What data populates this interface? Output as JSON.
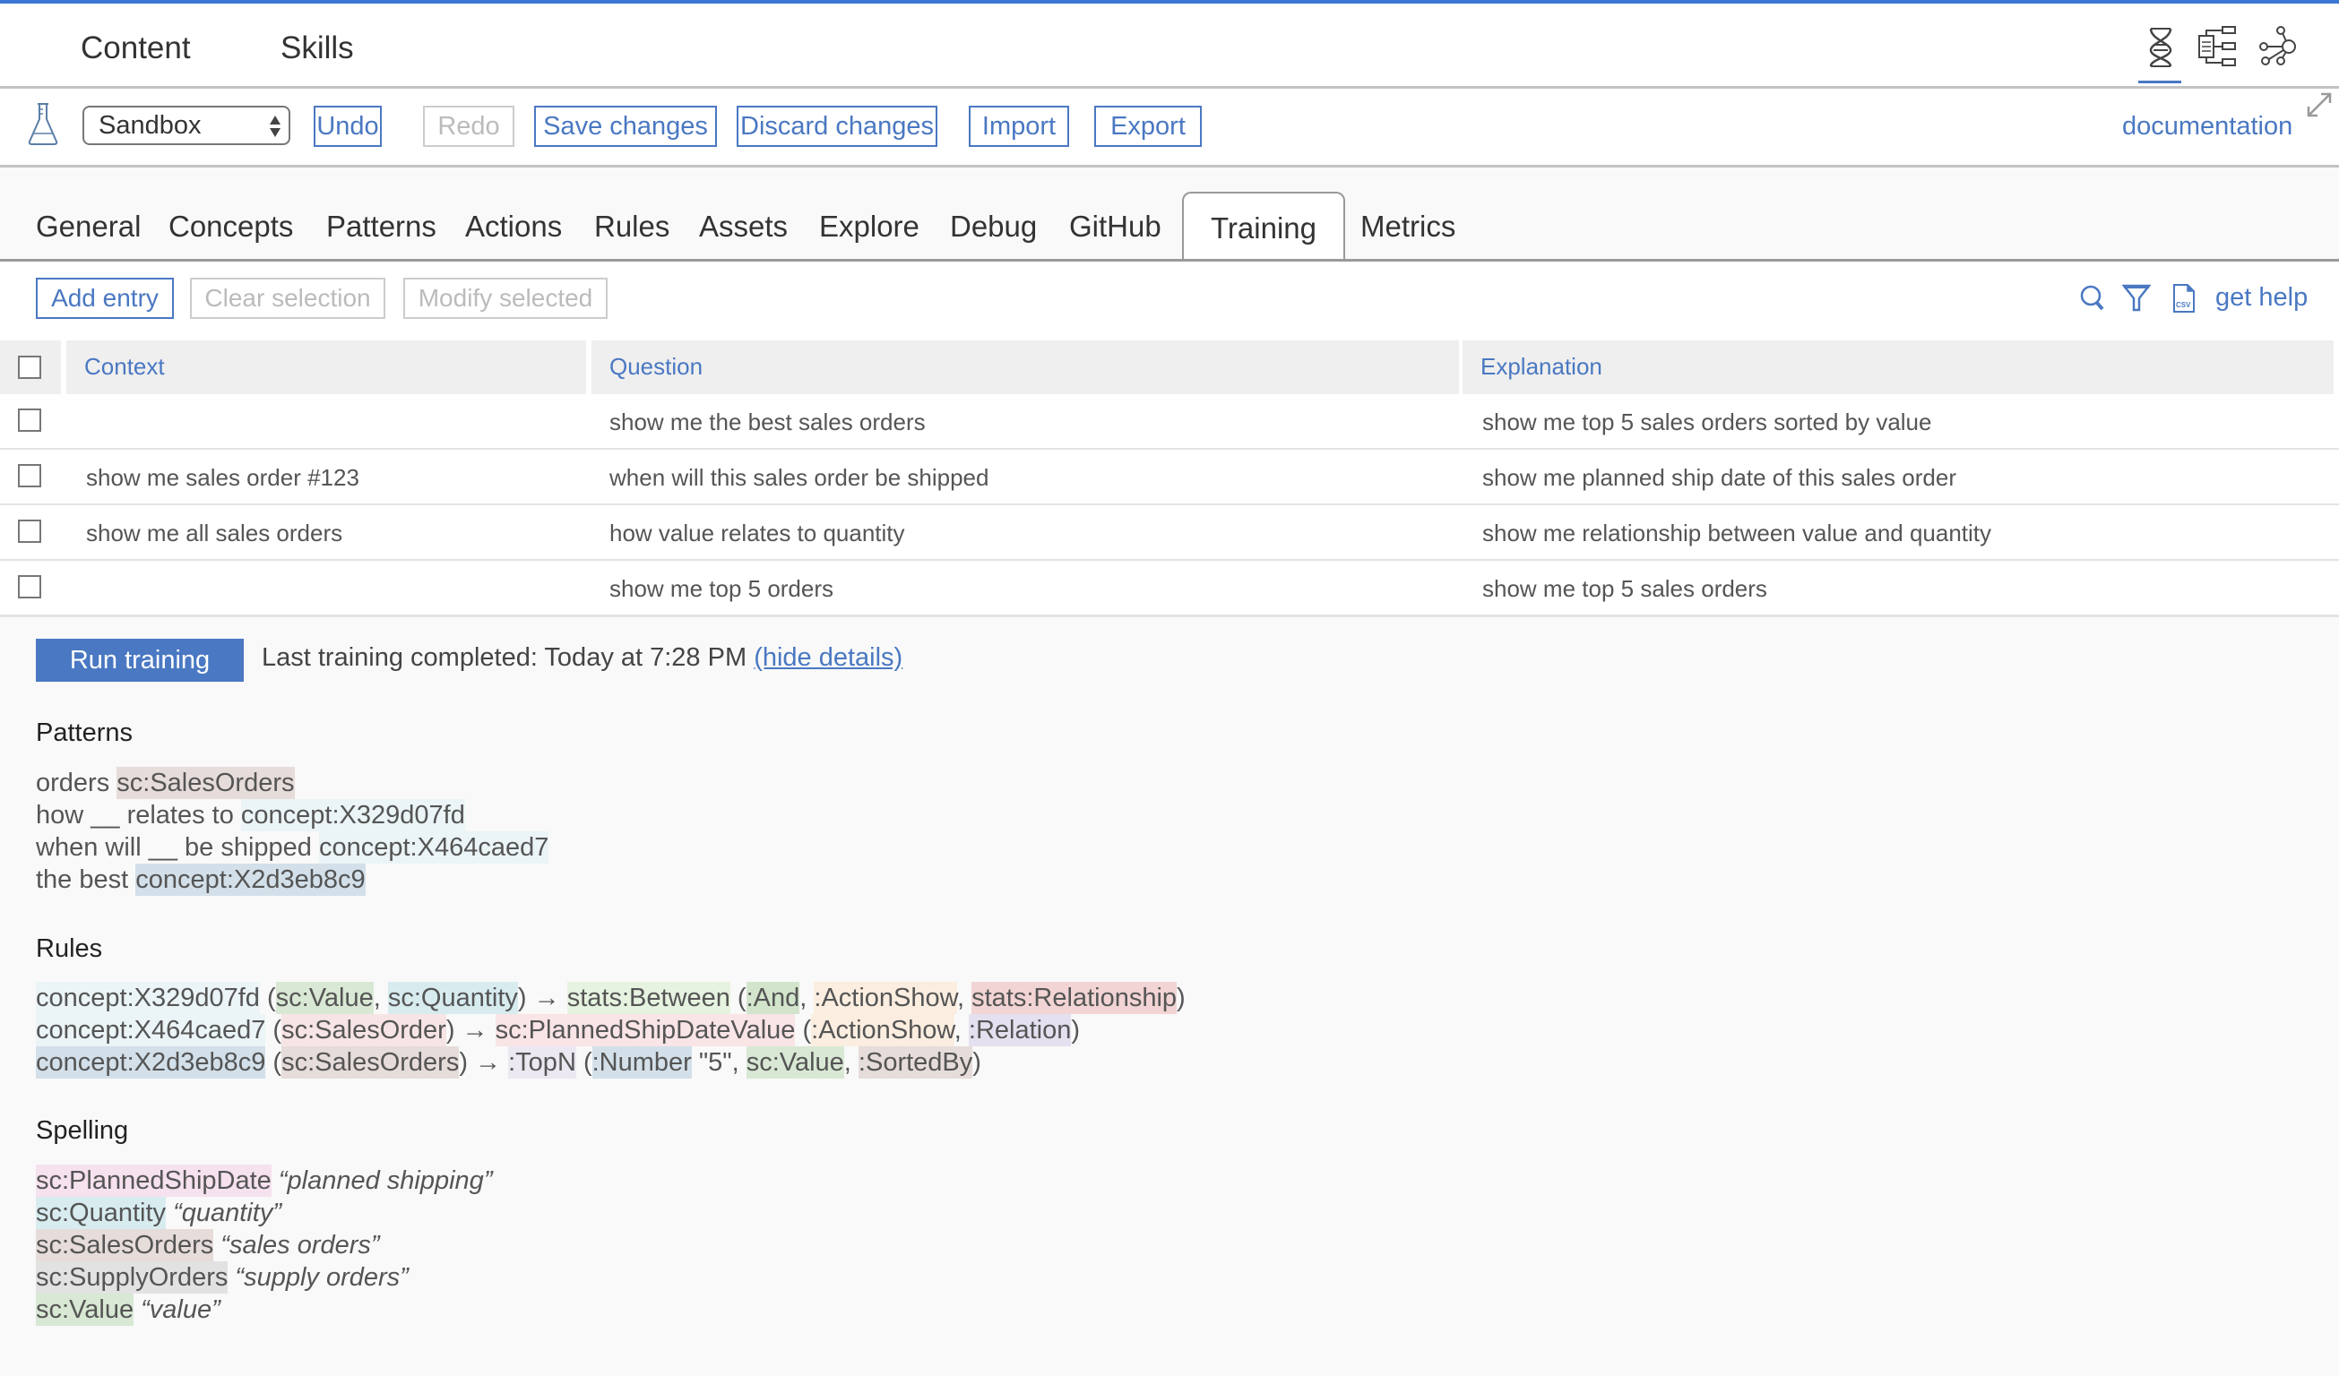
{
  "header": {
    "top_tabs": [
      "Content",
      "Skills"
    ],
    "right_icons": [
      "dna-icon",
      "tree-diagram-icon",
      "network-icon"
    ]
  },
  "toolbar": {
    "environment": "Sandbox",
    "undo": "Undo",
    "redo": "Redo",
    "save": "Save changes",
    "discard": "Discard changes",
    "import": "Import",
    "export": "Export",
    "documentation": "documentation"
  },
  "tabs": [
    {
      "label": "General"
    },
    {
      "label": "Concepts"
    },
    {
      "label": "Patterns"
    },
    {
      "label": "Actions"
    },
    {
      "label": "Rules"
    },
    {
      "label": "Assets"
    },
    {
      "label": "Explore"
    },
    {
      "label": "Debug"
    },
    {
      "label": "GitHub"
    },
    {
      "label": "Training",
      "active": true
    },
    {
      "label": "Metrics"
    }
  ],
  "actions": {
    "add_entry": "Add entry",
    "clear_selection": "Clear selection",
    "modify_selected": "Modify selected",
    "get_help": "get help"
  },
  "table": {
    "columns": [
      "Context",
      "Question",
      "Explanation"
    ],
    "rows": [
      {
        "context": "",
        "question": "show me the best sales orders",
        "explanation": "show me top 5 sales orders sorted by value"
      },
      {
        "context": "show me sales order #123",
        "question": "when will this sales order be shipped",
        "explanation": "show me planned ship date of this sales order"
      },
      {
        "context": "show me all sales orders",
        "question": "how value relates to quantity",
        "explanation": "show me relationship between value and quantity"
      },
      {
        "context": "",
        "question": "show me top 5 orders",
        "explanation": "show me top 5 sales orders"
      }
    ]
  },
  "training": {
    "run_button": "Run training",
    "status": "Last training completed: Today at 7:28 PM ",
    "hide_details": "(hide details)"
  },
  "patterns": {
    "heading": "Patterns",
    "lines": [
      {
        "prefix": "orders ",
        "tag": "sc:SalesOrders"
      },
      {
        "prefix": "how __ relates to ",
        "tag": "concept:X329d07fd"
      },
      {
        "prefix": "when will __ be shipped ",
        "tag": "concept:X464caed7"
      },
      {
        "prefix": "the best ",
        "tag": "concept:X2d3eb8c9"
      }
    ]
  },
  "rules": {
    "heading": "Rules",
    "r1": {
      "concept": "concept:X329d07fd",
      "a1": "sc:Value",
      "a2": "sc:Quantity",
      "arrow": " → ",
      "fn": "stats:Between",
      "b1": ":And",
      "b2": ":ActionShow",
      "b3": "stats:Relationship"
    },
    "r2": {
      "concept": "concept:X464caed7",
      "a1": "sc:SalesOrder",
      "arrow": " → ",
      "fn": "sc:PlannedShipDateValue",
      "b1": ":ActionShow",
      "b2": ":Relation"
    },
    "r3": {
      "concept": "concept:X2d3eb8c9",
      "a1": "sc:SalesOrders",
      "arrow": " → ",
      "fn": ":TopN",
      "b1": ":Number",
      "b1val": " \"5\"",
      "b2": "sc:Value",
      "b3": ":SortedBy"
    }
  },
  "spelling": {
    "heading": "Spelling",
    "entries": [
      {
        "tag": "sc:PlannedShipDate",
        "text": "“planned shipping”"
      },
      {
        "tag": "sc:Quantity",
        "text": "“quantity”"
      },
      {
        "tag": "sc:SalesOrders",
        "text": "“sales orders”"
      },
      {
        "tag": "sc:SupplyOrders",
        "text": "“supply orders”"
      },
      {
        "tag": "sc:Value",
        "text": "“value”"
      }
    ]
  },
  "colors": {
    "accent": "#4a78c2",
    "top_border": "#3b76d3"
  }
}
